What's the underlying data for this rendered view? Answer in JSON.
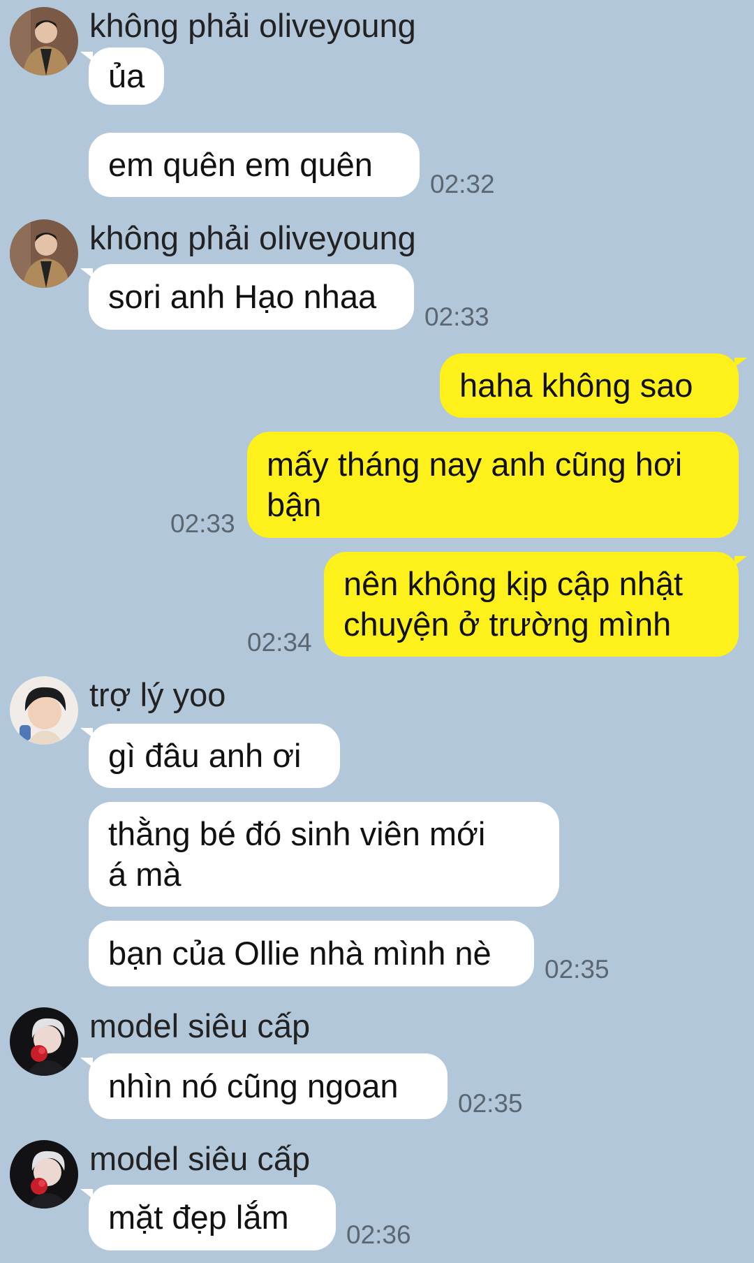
{
  "colors": {
    "background": "#b2c7da",
    "incoming_bubble": "#ffffff",
    "outgoing_bubble": "#fef01b",
    "timestamp": "#5b6670"
  },
  "messages": [
    {
      "sender": "không phải oliveyoung",
      "avatar_icon": "profile-photo-man-jacket-icon",
      "texts": [
        "ủa",
        "em quên em quên"
      ],
      "time": "02:32"
    },
    {
      "sender": "không phải oliveyoung",
      "avatar_icon": "profile-photo-man-jacket-icon",
      "texts": [
        "sori anh Hạo nhaa"
      ],
      "time": "02:33"
    },
    {
      "sender": "",
      "outgoing": true,
      "texts": [
        "haha không sao",
        "mấy tháng nay anh cũng hơi\nbận"
      ],
      "time": "02:33"
    },
    {
      "sender": "",
      "outgoing": true,
      "texts": [
        "nên không kịp cập nhật\nchuyện ở trường mình"
      ],
      "time": "02:34"
    },
    {
      "sender": "trợ lý yoo",
      "avatar_icon": "profile-photo-boy-dark-hair-icon",
      "texts": [
        "gì đâu anh ơi",
        "thằng bé đó sinh viên mới\ná mà",
        "bạn của Ollie nhà mình nè"
      ],
      "time": "02:35"
    },
    {
      "sender": "model siêu cấp",
      "avatar_icon": "profile-photo-silver-hair-icon",
      "texts": [
        "nhìn nó cũng ngoan"
      ],
      "time": "02:35"
    },
    {
      "sender": "model siêu cấp",
      "avatar_icon": "profile-photo-silver-hair-icon",
      "texts": [
        "mặt đẹp lắm"
      ],
      "time": "02:36"
    }
  ]
}
